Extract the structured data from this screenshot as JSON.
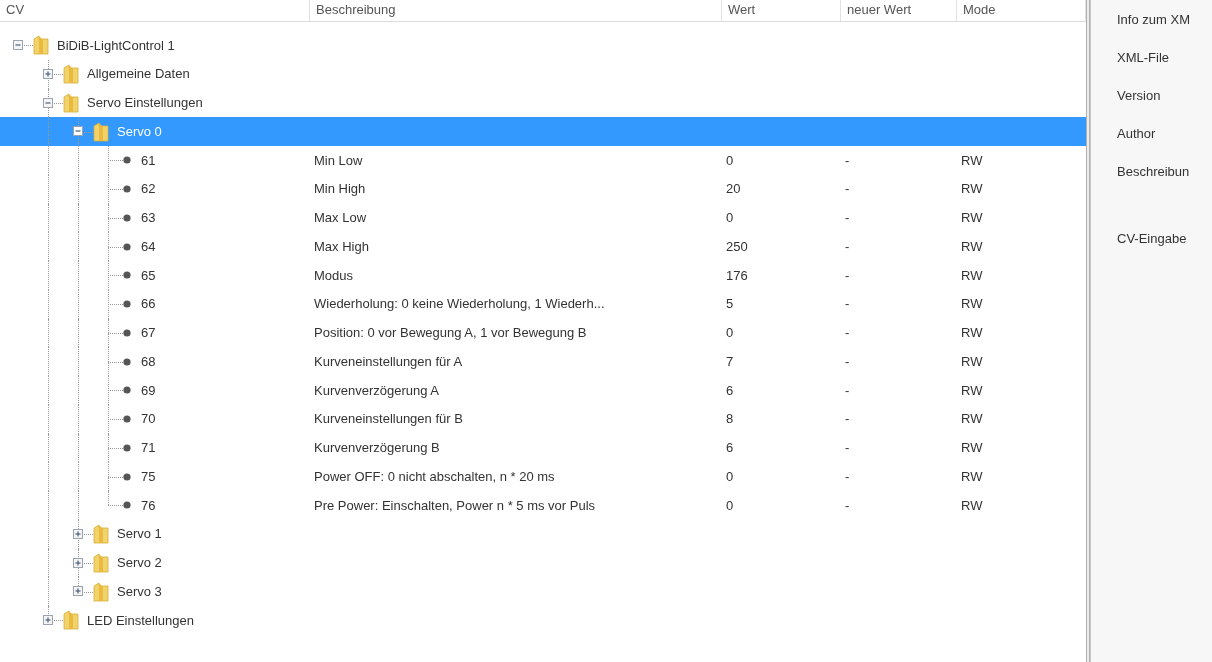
{
  "table": {
    "columns": [
      "CV",
      "Beschreibung",
      "Wert",
      "neuer Wert",
      "Mode"
    ],
    "tree": [
      {
        "kind": "folder",
        "label": "BiDiB-LightControl 1",
        "expanded": true,
        "selected": false,
        "children": [
          {
            "kind": "folder",
            "label": "Allgemeine Daten",
            "expanded": false,
            "selected": false
          },
          {
            "kind": "folder",
            "label": "Servo Einstellungen",
            "expanded": true,
            "selected": false,
            "children": [
              {
                "kind": "folder",
                "label": "Servo 0",
                "expanded": true,
                "selected": true,
                "children": [
                  {
                    "kind": "cv",
                    "cv": "61",
                    "description": "Min Low",
                    "value": "0",
                    "new_value": "-",
                    "mode": "RW"
                  },
                  {
                    "kind": "cv",
                    "cv": "62",
                    "description": "Min High",
                    "value": "20",
                    "new_value": "-",
                    "mode": "RW"
                  },
                  {
                    "kind": "cv",
                    "cv": "63",
                    "description": "Max Low",
                    "value": "0",
                    "new_value": "-",
                    "mode": "RW"
                  },
                  {
                    "kind": "cv",
                    "cv": "64",
                    "description": "Max High",
                    "value": "250",
                    "new_value": "-",
                    "mode": "RW"
                  },
                  {
                    "kind": "cv",
                    "cv": "65",
                    "description": "Modus",
                    "value": "176",
                    "new_value": "-",
                    "mode": "RW"
                  },
                  {
                    "kind": "cv",
                    "cv": "66",
                    "description": "Wiederholung: 0 keine Wiederholung, 1 Wiederh...",
                    "value": "5",
                    "new_value": "-",
                    "mode": "RW"
                  },
                  {
                    "kind": "cv",
                    "cv": "67",
                    "description": "Position: 0 vor Bewegung A, 1 vor Bewegung B",
                    "value": "0",
                    "new_value": "-",
                    "mode": "RW"
                  },
                  {
                    "kind": "cv",
                    "cv": "68",
                    "description": "Kurveneinstellungen für A",
                    "value": "7",
                    "new_value": "-",
                    "mode": "RW"
                  },
                  {
                    "kind": "cv",
                    "cv": "69",
                    "description": "Kurvenverzögerung A",
                    "value": "6",
                    "new_value": "-",
                    "mode": "RW"
                  },
                  {
                    "kind": "cv",
                    "cv": "70",
                    "description": "Kurveneinstellungen für B",
                    "value": "8",
                    "new_value": "-",
                    "mode": "RW"
                  },
                  {
                    "kind": "cv",
                    "cv": "71",
                    "description": "Kurvenverzögerung B",
                    "value": "6",
                    "new_value": "-",
                    "mode": "RW"
                  },
                  {
                    "kind": "cv",
                    "cv": "75",
                    "description": "Power OFF: 0 nicht abschalten, n * 20 ms",
                    "value": "0",
                    "new_value": "-",
                    "mode": "RW"
                  },
                  {
                    "kind": "cv",
                    "cv": "76",
                    "description": "Pre Power: Einschalten, Power n * 5 ms vor Puls",
                    "value": "0",
                    "new_value": "-",
                    "mode": "RW"
                  }
                ]
              },
              {
                "kind": "folder",
                "label": "Servo 1",
                "expanded": false,
                "selected": false
              },
              {
                "kind": "folder",
                "label": "Servo 2",
                "expanded": false,
                "selected": false
              },
              {
                "kind": "folder",
                "label": "Servo 3",
                "expanded": false,
                "selected": false
              }
            ]
          },
          {
            "kind": "folder",
            "label": "LED Einstellungen",
            "expanded": false,
            "selected": false
          }
        ]
      }
    ]
  },
  "info_panel": {
    "labels": [
      "Info zum XM",
      "XML-File",
      "Version",
      "Author",
      "Beschreibun",
      "CV-Eingabe"
    ]
  }
}
